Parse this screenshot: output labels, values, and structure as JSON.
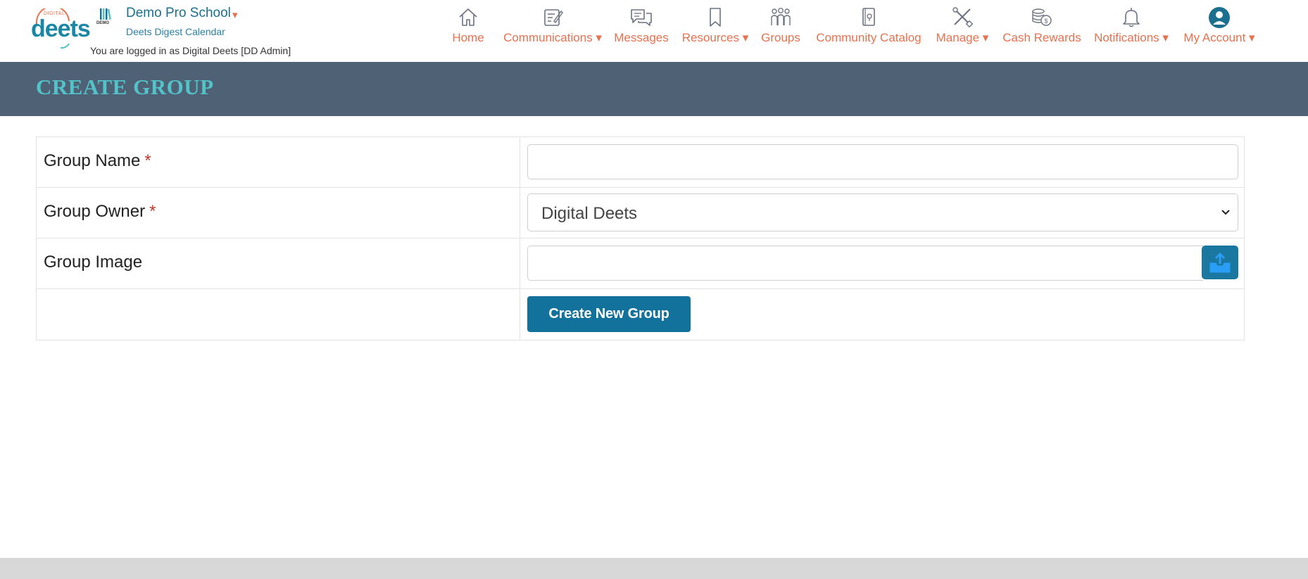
{
  "brand": {
    "digital_label": "DIGITAL",
    "deets_label": "deets"
  },
  "school": {
    "logo_label": "DEMO",
    "name": "Demo Pro School",
    "caret": "▾",
    "calendar_link": "Deets Digest Calendar",
    "login_text": "You are logged in as Digital Deets [DD Admin]"
  },
  "nav": {
    "items": [
      {
        "label": "Home",
        "icon": "home-icon"
      },
      {
        "label": "Communications ▾",
        "icon": "edit-note-icon"
      },
      {
        "label": "Messages",
        "icon": "chat-bubbles-icon"
      },
      {
        "label": "Resources ▾",
        "icon": "bookmark-icon"
      },
      {
        "label": "Groups",
        "icon": "people-icon"
      },
      {
        "label": "Community Catalog",
        "icon": "catalog-book-icon"
      },
      {
        "label": "Manage ▾",
        "icon": "tools-icon"
      },
      {
        "label": "Cash Rewards",
        "icon": "coins-icon"
      },
      {
        "label": "Notifications ▾",
        "icon": "bell-icon"
      },
      {
        "label": "My Account ▾",
        "icon": "user-avatar-icon"
      }
    ]
  },
  "page": {
    "title": "CREATE GROUP"
  },
  "form": {
    "group_name_label": "Group Name",
    "group_owner_label": "Group Owner",
    "group_image_label": "Group Image",
    "required_mark": "*",
    "group_name_value": "",
    "group_owner_value": "Digital Deets",
    "submit_label": "Create New Group"
  },
  "colors": {
    "accent_orange": "#e8714f",
    "brand_teal": "#1b87a6",
    "title_band": "#4f6175",
    "title_text": "#52c3c8",
    "primary_button": "#12729b"
  }
}
